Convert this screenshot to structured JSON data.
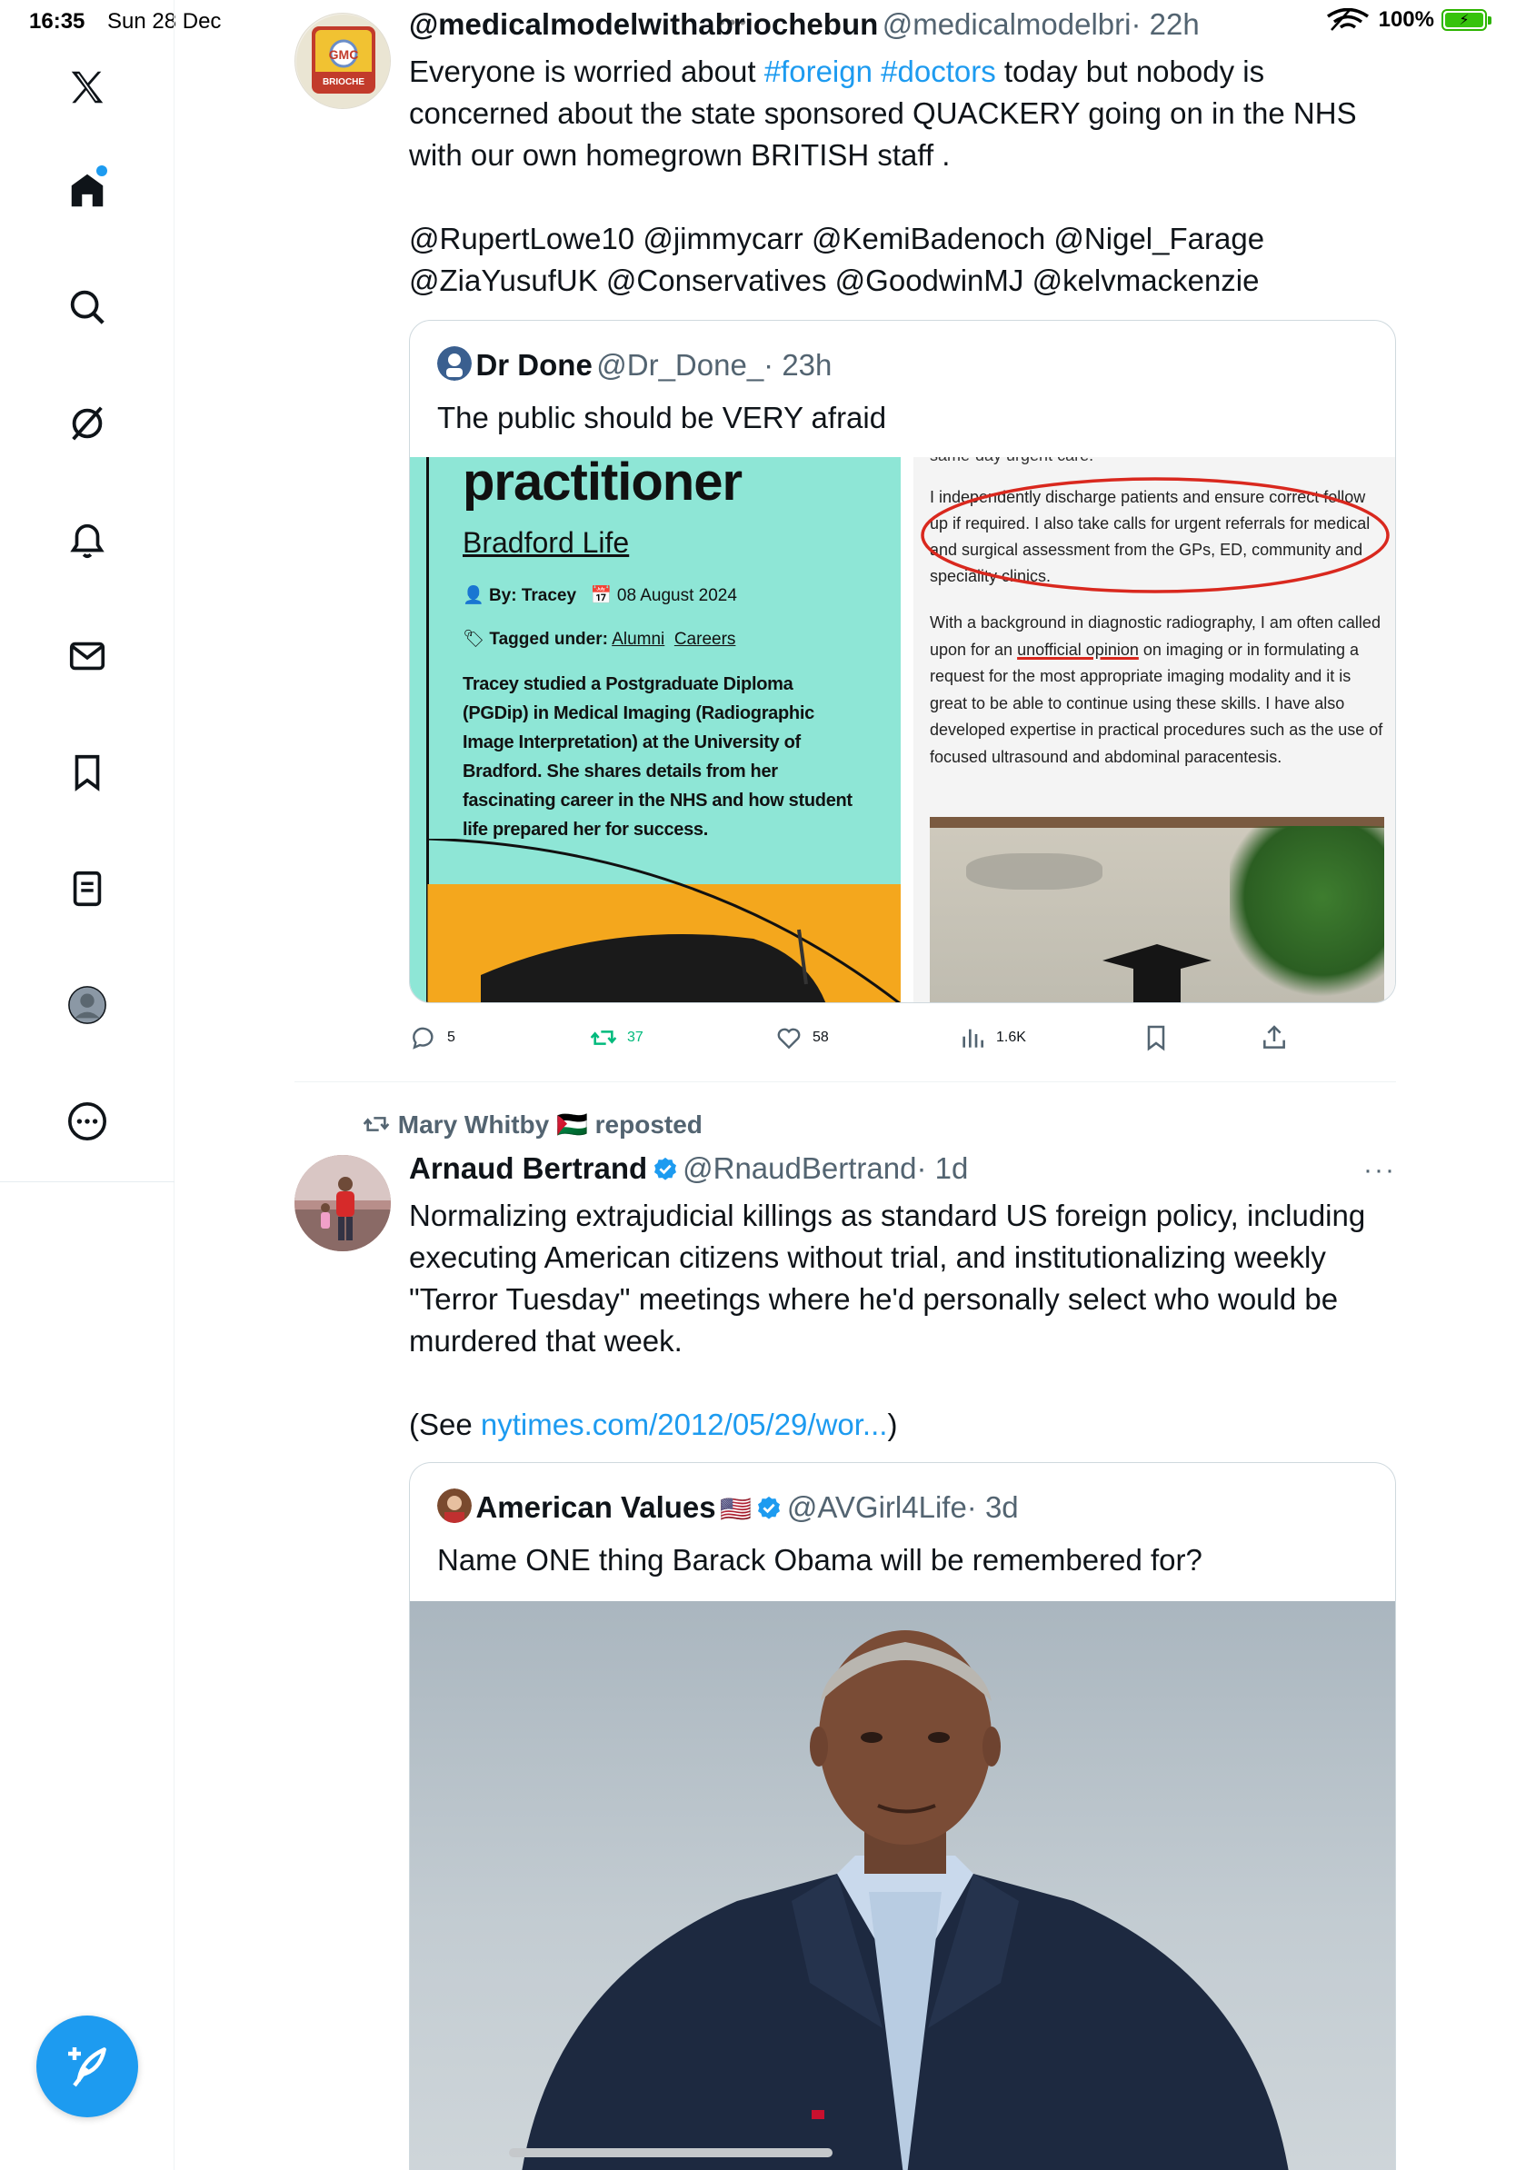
{
  "status": {
    "time": "16:35",
    "date": "Sun 28 Dec",
    "battery": "100%"
  },
  "tweet1": {
    "name": "@medicalmodelwithabriochebun",
    "handle": "@medicalmodelbri",
    "time": "· 22h",
    "avatar_text": "General Medical Council",
    "text_before": "Everyone is worried about ",
    "hashtag1": "#foreign",
    "hashtag2": "#doctors",
    "text_after": "  today but nobody is concerned about the state sponsored QUACKERY going on in the NHS with our own homegrown BRITISH staff .",
    "mentions": "@RupertLowe10 @jimmycarr @KemiBadenoch @Nigel_Farage @ZiaYusufUK @Conservatives @GoodwinMJ @kelvmackenzie",
    "quote": {
      "name": "Dr Done",
      "handle": "@Dr_Done_",
      "time": "· 23h",
      "text": "The public should be VERY afraid",
      "img_left": {
        "title": "practitioner",
        "subtitle": "Bradford Life",
        "by": "By: Tracey",
        "date": "08 August 2024",
        "tagged": "Tagged under:",
        "tag1": "Alumni",
        "tag2": "Careers",
        "body": "Tracey studied a Postgraduate Diploma (PGDip) in Medical Imaging (Radiographic Image Interpretation) at the University of Bradford. She shares details from her fascinating career in the NHS and how student life prepared her for success."
      },
      "img_right": {
        "top": "same-day urgent care.",
        "circled": "I independently discharge patients and ensure correct follow up if required.  I also take calls for urgent referrals for medical and surgical assessment from the GPs, ED, community and speciality clinics.",
        "para_before": "With a background in diagnostic radiography, I am often called upon for an ",
        "underlined": "unofficial opinion",
        "para_after": " on imaging or in formulating a request for the most appropriate imaging modality and it is great to be able to continue using these skills. I have also developed expertise in practical procedures such as the use of focused ultrasound and abdominal paracentesis."
      }
    },
    "actions": {
      "replies": "5",
      "reposts": "37",
      "likes": "58",
      "views": "1.6K"
    }
  },
  "tweet2": {
    "reposted_by": "Mary Whitby 🇵🇸 reposted",
    "name": "Arnaud Bertrand",
    "handle": "@RnaudBertrand",
    "time": "· 1d",
    "more": "···",
    "text": "Normalizing extrajudicial killings as standard US foreign policy, including executing American citizens without trial, and institutionalizing weekly \"Terror Tuesday\" meetings where he'd personally select who would be murdered that week.",
    "see_prefix": "(See ",
    "see_link": "nytimes.com/2012/05/29/wor...",
    "see_suffix": ")",
    "quote": {
      "name": "American Values",
      "flag": "🇺🇸",
      "handle": "@AVGirl4Life",
      "time": "· 3d",
      "text": "Name ONE thing Barack Obama will be remembered for?"
    }
  },
  "colors": {
    "accent": "#1d9bf0",
    "repost_green": "#00ba7c",
    "muted": "#536471",
    "circle_red": "#d9281e"
  }
}
